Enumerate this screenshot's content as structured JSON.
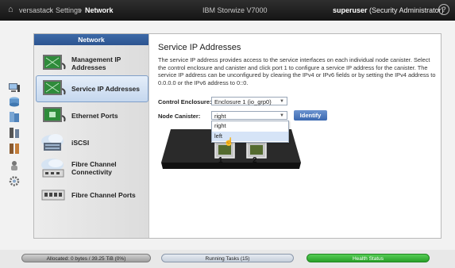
{
  "topbar": {
    "breadcrumbs": [
      "versastack",
      "Settings",
      "Network"
    ],
    "product": "IBM Storwize V7000",
    "user_name": "superuser",
    "user_role": "(Security Administrator)",
    "help_label": "?"
  },
  "left_toolbar": {
    "icons": [
      "monitoring-icon",
      "pools-icon",
      "volumes-icon",
      "hosts-icon",
      "copy-services-icon",
      "access-icon",
      "settings-icon"
    ]
  },
  "network_nav": {
    "header": "Network",
    "items": [
      {
        "label": "Management IP Addresses",
        "icon": "management-ip-icon",
        "selected": false
      },
      {
        "label": "Service IP Addresses",
        "icon": "service-ip-icon",
        "selected": true
      },
      {
        "label": "Ethernet Ports",
        "icon": "ethernet-ports-icon",
        "selected": false
      },
      {
        "label": "iSCSI",
        "icon": "iscsi-icon",
        "selected": false
      },
      {
        "label": "Fibre Channel Connectivity",
        "icon": "fc-connectivity-icon",
        "selected": false
      },
      {
        "label": "Fibre Channel Ports",
        "icon": "fc-ports-icon",
        "selected": false
      }
    ]
  },
  "content": {
    "title": "Service IP Addresses",
    "description": "The service IP address provides access to the service interfaces on each individual node canister. Select the control enclosure and canister and click port 1 to configure a service IP address for the canister. The service IP address can be unconfigured by clearing the IPv4 or IPv6 fields or by setting the IPv4 address to 0.0.0.0 or the IPv6 address to 0::0.",
    "control_enclosure_label": "Control Enclosure:",
    "control_enclosure_value": "Enclosure 1 (io_grp0)",
    "node_canister_label": "Node Canister:",
    "node_canister_value": "right",
    "node_canister_options": [
      "right",
      "left"
    ],
    "identify_label": "Identify",
    "canister_labels": [
      "1",
      "2"
    ]
  },
  "statusbar": {
    "allocated": "Allocated: 0 bytes / 39.25 TiB (0%)",
    "running_tasks": "Running Tasks (15)",
    "health": "Health Status"
  },
  "colors": {
    "nav_header": "#2c5490",
    "identify_button": "#3a68b0",
    "health_ok": "#29a129"
  }
}
